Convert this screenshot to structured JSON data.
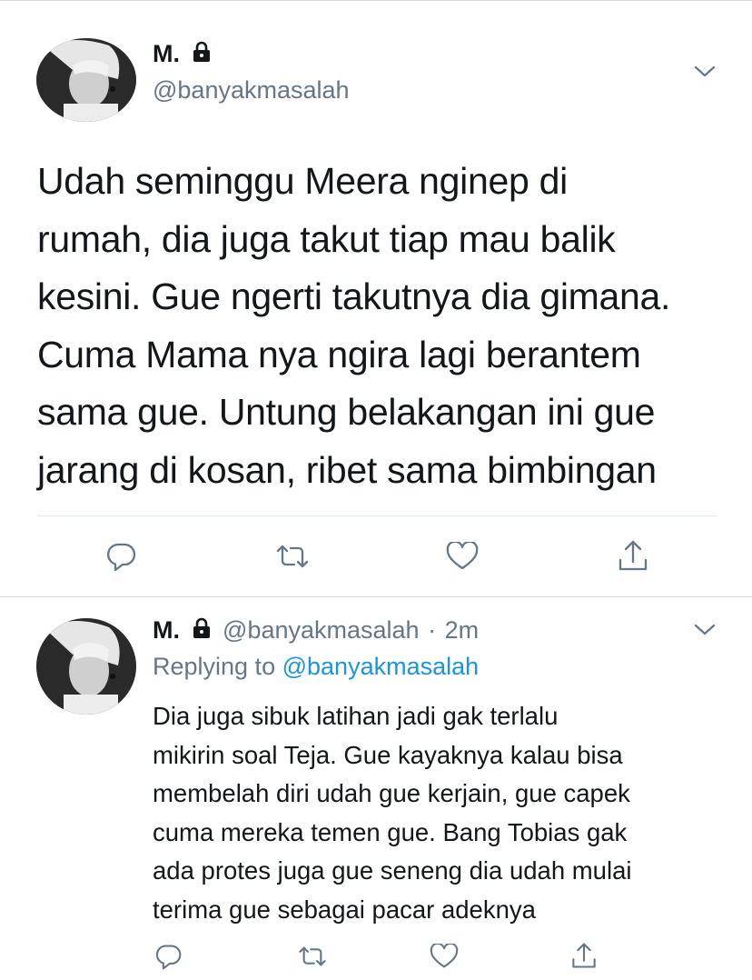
{
  "main_tweet": {
    "display_name": "M.",
    "handle": "@banyakmasalah",
    "icons": {
      "protected": "lock-icon",
      "menu": "chevron-down-icon"
    },
    "lines": [
      "Udah seminggu Meera nginep di",
      "rumah, dia juga takut tiap mau balik",
      "kesini. Gue ngerti takutnya dia gimana.",
      "Cuma Mama nya ngira lagi berantem",
      "sama gue. Untung belakangan ini gue",
      "jarang di kosan, ribet sama bimbingan"
    ],
    "actions": [
      "reply-icon",
      "retweet-icon",
      "like-icon",
      "share-icon"
    ]
  },
  "reply_tweet": {
    "display_name": "M.",
    "handle": "@banyakmasalah",
    "separator": "·",
    "time": "2m",
    "replying_prefix": "Replying to",
    "replying_to": "@banyakmasalah",
    "lines": [
      "Dia juga sibuk latihan jadi gak terlalu",
      "mikirin soal Teja. Gue kayaknya kalau bisa",
      "membelah diri udah gue kerjain, gue capek",
      "cuma mereka temen gue. Bang Tobias gak",
      "ada protes juga gue seneng dia udah mulai",
      "terima gue sebagai pacar adeknya"
    ],
    "actions": [
      "reply-icon",
      "retweet-icon",
      "like-icon",
      "share-icon"
    ]
  },
  "colors": {
    "text": "#14171a",
    "secondary": "#657786",
    "link": "#1b95e0",
    "icon": "#657786",
    "divider": "#e1e8ed"
  }
}
